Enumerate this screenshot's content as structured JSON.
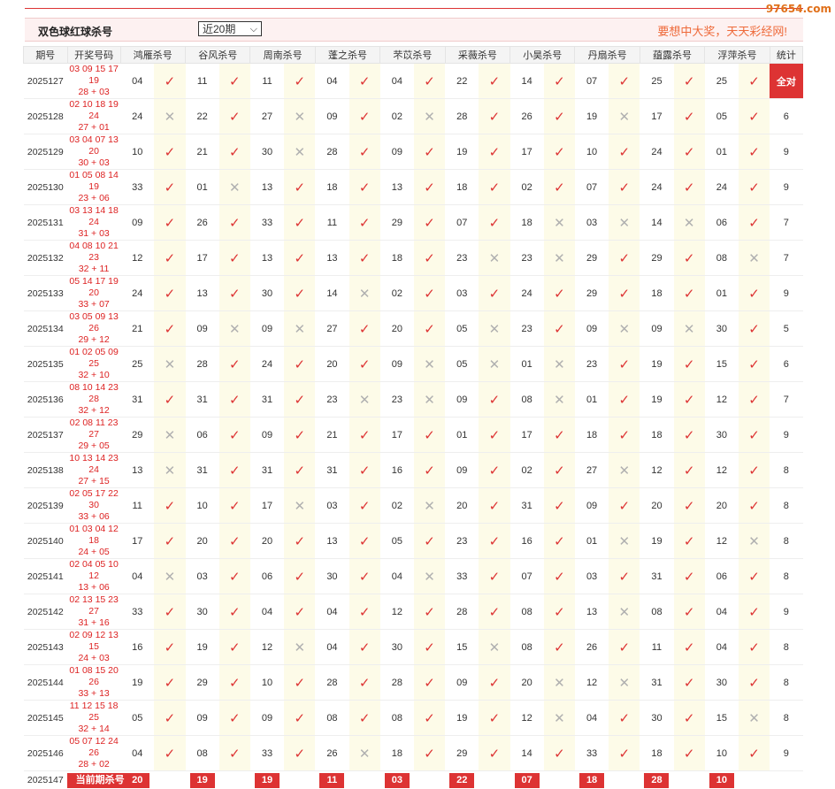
{
  "watermark": "97654.com",
  "header": {
    "title": "双色球红球杀号",
    "period_select": "近20期",
    "slogan": "要想中大奖，天天彩经网!"
  },
  "columns": {
    "period": "期号",
    "draw": "开奖号码",
    "experts": [
      "鸿雁杀号",
      "谷风杀号",
      "周南杀号",
      "蓬之杀号",
      "芣苡杀号",
      "采薇杀号",
      "小昊杀号",
      "丹扇杀号",
      "蕴露杀号",
      "浮萍杀号"
    ],
    "stat": "统计"
  },
  "rows": [
    {
      "period": "2025127",
      "draw1": "03 09 15 17 19",
      "draw2": "28 + 03",
      "kills": [
        "04",
        "11",
        "11",
        "04",
        "04",
        "22",
        "14",
        "07",
        "25",
        "25"
      ],
      "ok": [
        1,
        1,
        1,
        1,
        1,
        1,
        1,
        1,
        1,
        1
      ],
      "stat": "全对"
    },
    {
      "period": "2025128",
      "draw1": "02 10 18 19 24",
      "draw2": "27 + 01",
      "kills": [
        "24",
        "22",
        "27",
        "09",
        "02",
        "28",
        "26",
        "19",
        "17",
        "05"
      ],
      "ok": [
        0,
        1,
        0,
        1,
        0,
        1,
        1,
        0,
        1,
        1
      ],
      "stat": "6"
    },
    {
      "period": "2025129",
      "draw1": "03 04 07 13 20",
      "draw2": "30 + 03",
      "kills": [
        "10",
        "21",
        "30",
        "28",
        "09",
        "19",
        "17",
        "10",
        "24",
        "01"
      ],
      "ok": [
        1,
        1,
        0,
        1,
        1,
        1,
        1,
        1,
        1,
        1
      ],
      "stat": "9"
    },
    {
      "period": "2025130",
      "draw1": "01 05 08 14 19",
      "draw2": "23 + 06",
      "kills": [
        "33",
        "01",
        "13",
        "18",
        "13",
        "18",
        "02",
        "07",
        "24",
        "24"
      ],
      "ok": [
        1,
        0,
        1,
        1,
        1,
        1,
        1,
        1,
        1,
        1
      ],
      "stat": "9"
    },
    {
      "period": "2025131",
      "draw1": "03 13 14 18 24",
      "draw2": "31 + 03",
      "kills": [
        "09",
        "26",
        "33",
        "11",
        "29",
        "07",
        "18",
        "03",
        "14",
        "06"
      ],
      "ok": [
        1,
        1,
        1,
        1,
        1,
        1,
        0,
        0,
        0,
        1
      ],
      "stat": "7"
    },
    {
      "period": "2025132",
      "draw1": "04 08 10 21 23",
      "draw2": "32 + 11",
      "kills": [
        "12",
        "17",
        "13",
        "13",
        "18",
        "23",
        "23",
        "29",
        "29",
        "08"
      ],
      "ok": [
        1,
        1,
        1,
        1,
        1,
        0,
        0,
        1,
        1,
        0
      ],
      "stat": "7"
    },
    {
      "period": "2025133",
      "draw1": "05 14 17 19 20",
      "draw2": "33 + 07",
      "kills": [
        "24",
        "13",
        "30",
        "14",
        "02",
        "03",
        "24",
        "29",
        "18",
        "01"
      ],
      "ok": [
        1,
        1,
        1,
        0,
        1,
        1,
        1,
        1,
        1,
        1
      ],
      "stat": "9"
    },
    {
      "period": "2025134",
      "draw1": "03 05 09 13 26",
      "draw2": "29 + 12",
      "kills": [
        "21",
        "09",
        "09",
        "27",
        "20",
        "05",
        "23",
        "09",
        "09",
        "30"
      ],
      "ok": [
        1,
        0,
        0,
        1,
        1,
        0,
        1,
        0,
        0,
        1
      ],
      "stat": "5"
    },
    {
      "period": "2025135",
      "draw1": "01 02 05 09 25",
      "draw2": "32 + 10",
      "kills": [
        "25",
        "28",
        "24",
        "20",
        "09",
        "05",
        "01",
        "23",
        "19",
        "15"
      ],
      "ok": [
        0,
        1,
        1,
        1,
        0,
        0,
        0,
        1,
        1,
        1
      ],
      "stat": "6"
    },
    {
      "period": "2025136",
      "draw1": "08 10 14 23 28",
      "draw2": "32 + 12",
      "kills": [
        "31",
        "31",
        "31",
        "23",
        "23",
        "09",
        "08",
        "01",
        "19",
        "12"
      ],
      "ok": [
        1,
        1,
        1,
        0,
        0,
        1,
        0,
        1,
        1,
        1
      ],
      "stat": "7"
    },
    {
      "period": "2025137",
      "draw1": "02 08 11 23 27",
      "draw2": "29 + 05",
      "kills": [
        "29",
        "06",
        "09",
        "21",
        "17",
        "01",
        "17",
        "18",
        "18",
        "30"
      ],
      "ok": [
        0,
        1,
        1,
        1,
        1,
        1,
        1,
        1,
        1,
        1
      ],
      "stat": "9"
    },
    {
      "period": "2025138",
      "draw1": "10 13 14 23 24",
      "draw2": "27 + 15",
      "kills": [
        "13",
        "31",
        "31",
        "31",
        "16",
        "09",
        "02",
        "27",
        "12",
        "12"
      ],
      "ok": [
        0,
        1,
        1,
        1,
        1,
        1,
        1,
        0,
        1,
        1
      ],
      "stat": "8"
    },
    {
      "period": "2025139",
      "draw1": "02 05 17 22 30",
      "draw2": "33 + 06",
      "kills": [
        "11",
        "10",
        "17",
        "03",
        "02",
        "20",
        "31",
        "09",
        "20",
        "20"
      ],
      "ok": [
        1,
        1,
        0,
        1,
        0,
        1,
        1,
        1,
        1,
        1
      ],
      "stat": "8"
    },
    {
      "period": "2025140",
      "draw1": "01 03 04 12 18",
      "draw2": "24 + 05",
      "kills": [
        "17",
        "20",
        "20",
        "13",
        "05",
        "23",
        "16",
        "01",
        "19",
        "12"
      ],
      "ok": [
        1,
        1,
        1,
        1,
        1,
        1,
        1,
        0,
        1,
        0
      ],
      "stat": "8"
    },
    {
      "period": "2025141",
      "draw1": "02 04 05 10 12",
      "draw2": "13 + 06",
      "kills": [
        "04",
        "03",
        "06",
        "30",
        "04",
        "33",
        "07",
        "03",
        "31",
        "06"
      ],
      "ok": [
        0,
        1,
        1,
        1,
        0,
        1,
        1,
        1,
        1,
        1
      ],
      "stat": "8"
    },
    {
      "period": "2025142",
      "draw1": "02 13 15 23 27",
      "draw2": "31 + 16",
      "kills": [
        "33",
        "30",
        "04",
        "04",
        "12",
        "28",
        "08",
        "13",
        "08",
        "04"
      ],
      "ok": [
        1,
        1,
        1,
        1,
        1,
        1,
        1,
        0,
        1,
        1
      ],
      "stat": "9"
    },
    {
      "period": "2025143",
      "draw1": "02 09 12 13 15",
      "draw2": "24 + 03",
      "kills": [
        "16",
        "19",
        "12",
        "04",
        "30",
        "15",
        "08",
        "26",
        "11",
        "04"
      ],
      "ok": [
        1,
        1,
        0,
        1,
        1,
        0,
        1,
        1,
        1,
        1
      ],
      "stat": "8"
    },
    {
      "period": "2025144",
      "draw1": "01 08 15 20 26",
      "draw2": "33 + 13",
      "kills": [
        "19",
        "29",
        "10",
        "28",
        "28",
        "09",
        "20",
        "12",
        "31",
        "30"
      ],
      "ok": [
        1,
        1,
        1,
        1,
        1,
        1,
        0,
        0,
        1,
        1
      ],
      "stat": "8"
    },
    {
      "period": "2025145",
      "draw1": "11 12 15 18 25",
      "draw2": "32 + 14",
      "kills": [
        "05",
        "09",
        "09",
        "08",
        "08",
        "19",
        "12",
        "04",
        "30",
        "15"
      ],
      "ok": [
        1,
        1,
        1,
        1,
        1,
        1,
        0,
        1,
        1,
        0
      ],
      "stat": "8"
    },
    {
      "period": "2025146",
      "draw1": "05 07 12 24 26",
      "draw2": "28 + 02",
      "kills": [
        "04",
        "08",
        "33",
        "26",
        "18",
        "29",
        "14",
        "33",
        "18",
        "10"
      ],
      "ok": [
        1,
        1,
        1,
        0,
        1,
        1,
        1,
        1,
        1,
        1
      ],
      "stat": "9"
    }
  ],
  "current": {
    "period": "2025147",
    "label": "当前期杀号",
    "kills": [
      "20",
      "19",
      "19",
      "11",
      "03",
      "22",
      "07",
      "18",
      "28",
      "10"
    ]
  },
  "marks": {
    "ok": "✓",
    "no": "✕"
  },
  "colors": {
    "accent": "#dd3333",
    "mark_bg": "#fdfbe8",
    "slogan": "#ee6a3a"
  }
}
